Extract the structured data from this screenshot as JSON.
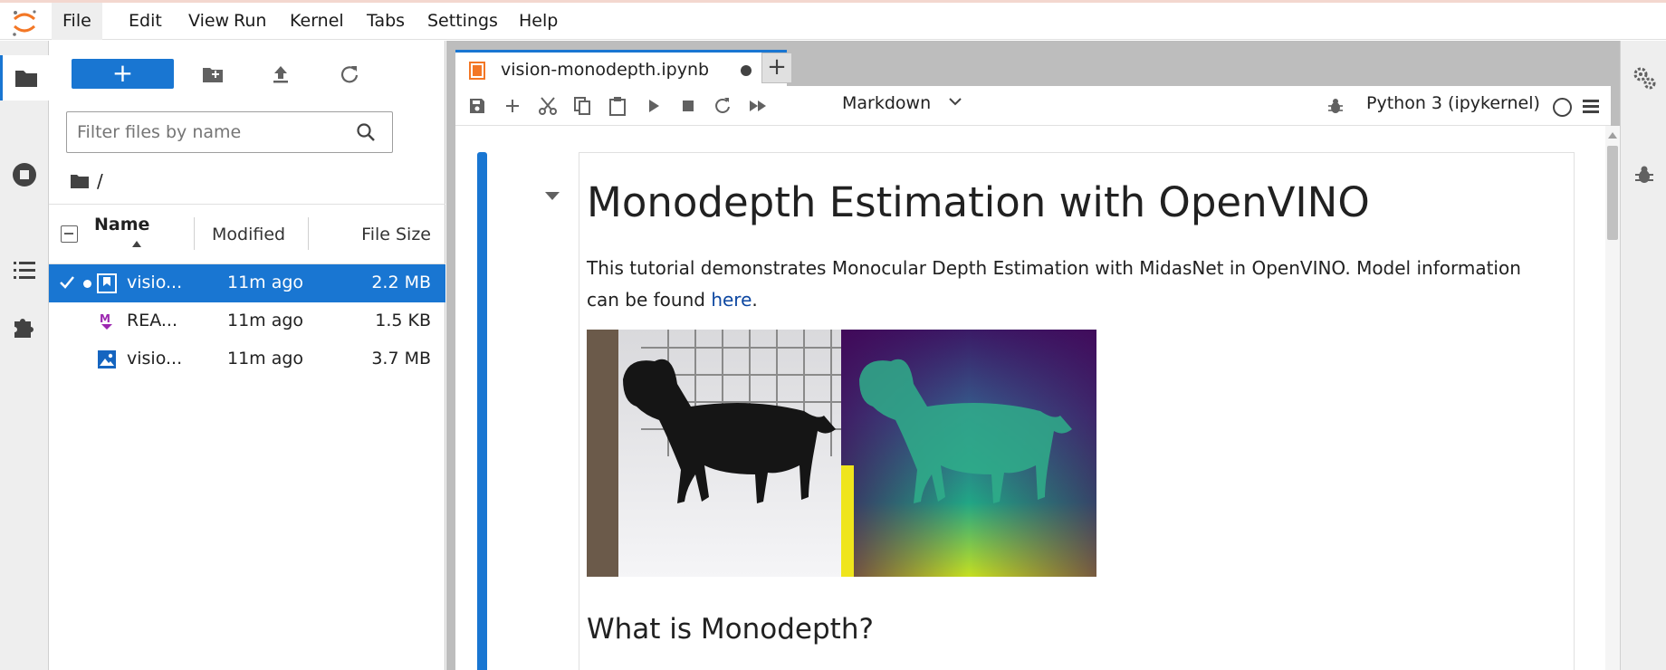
{
  "menu": {
    "items": [
      {
        "label": "File",
        "active": true
      },
      {
        "label": "Edit"
      },
      {
        "label": "View"
      },
      {
        "label": "Run"
      },
      {
        "label": "Kernel"
      },
      {
        "label": "Tabs"
      },
      {
        "label": "Settings"
      },
      {
        "label": "Help"
      }
    ]
  },
  "activity_bar": {
    "icons": [
      "folder-icon",
      "stop-circle-icon",
      "list-icon",
      "puzzle-icon"
    ],
    "active": "folder-icon"
  },
  "file_browser": {
    "new_button": "+",
    "filter_placeholder": "Filter files by name",
    "breadcrumb": "/",
    "columns": {
      "name": "Name",
      "modified": "Modified",
      "size": "File Size"
    },
    "files": [
      {
        "name": "visio...",
        "modified": "11m ago",
        "size": "2.2 MB",
        "icon": "notebook-icon",
        "selected": true,
        "running": true
      },
      {
        "name": "REA...",
        "modified": "11m ago",
        "size": "1.5 KB",
        "icon": "markdown-icon",
        "selected": false
      },
      {
        "name": "visio...",
        "modified": "11m ago",
        "size": "3.7 MB",
        "icon": "image-icon",
        "selected": false
      }
    ]
  },
  "tabs": [
    {
      "title": "vision-monodepth.ipynb",
      "modified": true
    }
  ],
  "notebook_toolbar": {
    "cell_type": "Markdown",
    "kernel": "Python 3 (ipykernel)"
  },
  "cell": {
    "heading": "Monodepth Estimation with OpenVINO",
    "intro": "This tutorial demonstrates Monocular Depth Estimation with MidasNet in OpenVINO. Model information can be found ",
    "link_text": "here",
    "intro_end": ".",
    "subheading": "What is Monodepth?"
  },
  "colors": {
    "accent": "#1976d2",
    "logo_orange": "#f37726",
    "markdown_purple": "#9c27b0",
    "image_blue": "#1565c0"
  },
  "right_bar": {
    "icons": [
      "property-inspector-icon",
      "debugger-icon"
    ]
  }
}
